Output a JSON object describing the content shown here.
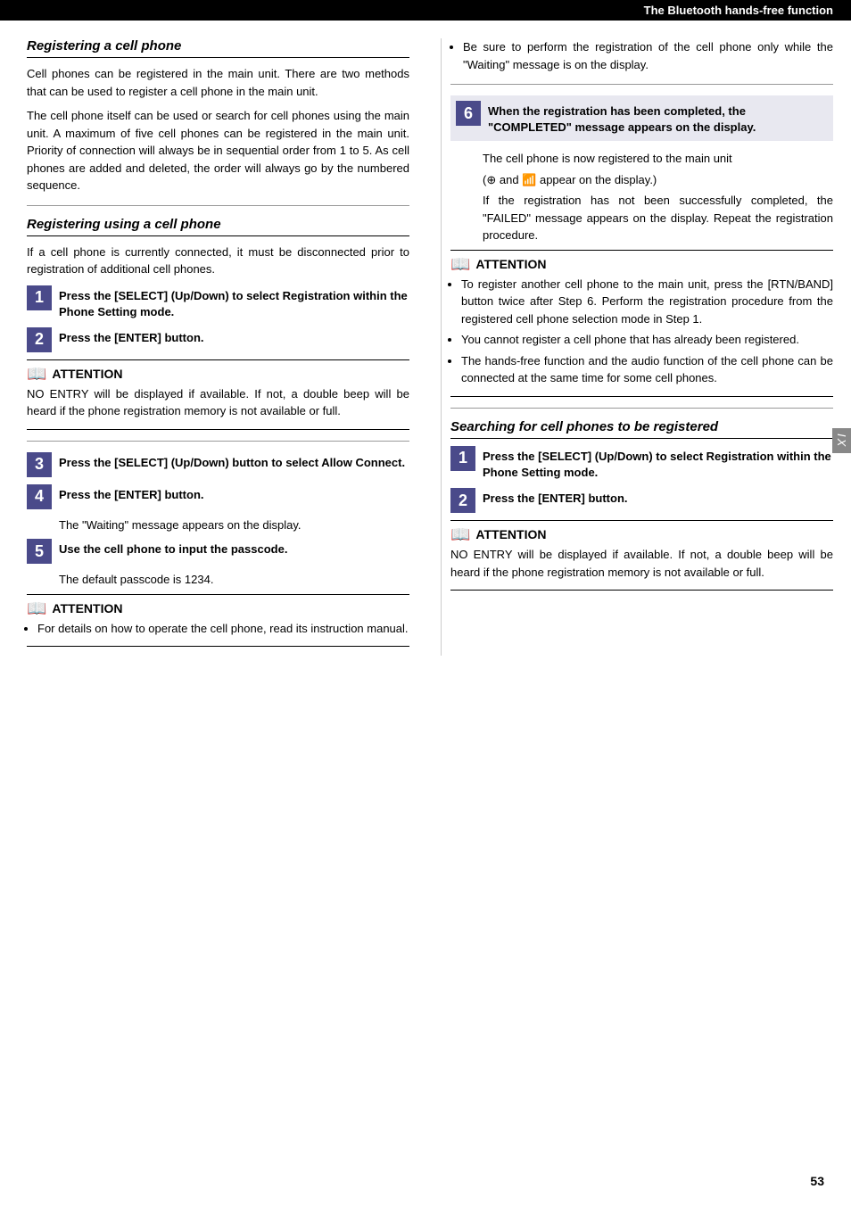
{
  "header": {
    "title": "The Bluetooth hands-free function"
  },
  "left": {
    "section1_title": "Registering a cell phone",
    "section1_p1": "Cell phones can be registered in the main unit. There are two methods that can be used to register a cell phone in the main unit.",
    "section1_p2": "The cell phone itself can be used or search for cell phones using the main unit. A maximum of five cell phones can be registered in the main unit. Priority of connection will always be in sequential order from 1 to 5. As cell phones are added and deleted, the order will always go by the numbered sequence.",
    "section2_title": "Registering using a cell phone",
    "section2_p1": "If a cell phone is currently connected, it must be disconnected prior to registration of additional cell phones.",
    "step1_text": "Press the [SELECT] (Up/Down) to select Registration within the Phone Setting mode.",
    "step2_text": "Press the [ENTER] button.",
    "attention1_label": "ATTENTION",
    "attention1_text": "NO ENTRY will be displayed if available. If not, a double beep will be heard if the phone registration memory is not available or full.",
    "step3_text": "Press the [SELECT] (Up/Down) button to select Allow Connect.",
    "step4_text": "Press the [ENTER] button.",
    "step4_sub": "The \"Waiting\" message appears on the display.",
    "step5_text": "Use the cell phone to input the passcode.",
    "step5_sub": "The default passcode is 1234.",
    "attention2_label": "ATTENTION",
    "attention2_bullet": "For details on how to operate the cell phone, read its instruction manual."
  },
  "right": {
    "bullet1": "Be sure to perform the registration of the cell phone only while the \"Waiting\" message is on the display.",
    "step6_text": "When the registration has been completed, the \"COMPLETED\" message appears on the display.",
    "step6_sub1": "The cell phone is now registered to the main unit",
    "step6_sub2": "(⊕ and 📶 appear on the display.)",
    "step6_sub3": "If the registration has not been successfully completed, the \"FAILED\" message appears on the display. Repeat the registration procedure.",
    "attention3_label": "ATTENTION",
    "attention3_bullets": [
      "To register another cell phone to the main unit, press the [RTN/BAND] button twice after Step 6. Perform the registration procedure from the registered cell phone selection mode in Step 1.",
      "You cannot register a cell phone that has already been registered.",
      "The hands-free function and the audio function of the cell phone can be connected at the same time for some cell phones."
    ],
    "section3_title": "Searching for cell phones to be registered",
    "rstep1_text": "Press the [SELECT] (Up/Down) to select Registration within the Phone Setting mode.",
    "rstep2_text": "Press the [ENTER] button.",
    "rattention_label": "ATTENTION",
    "rattention_text": "NO ENTRY will be displayed if available. If not, a double beep will be heard if the phone registration memory is not available or full."
  },
  "page_number": "53",
  "ix_label": "IX"
}
